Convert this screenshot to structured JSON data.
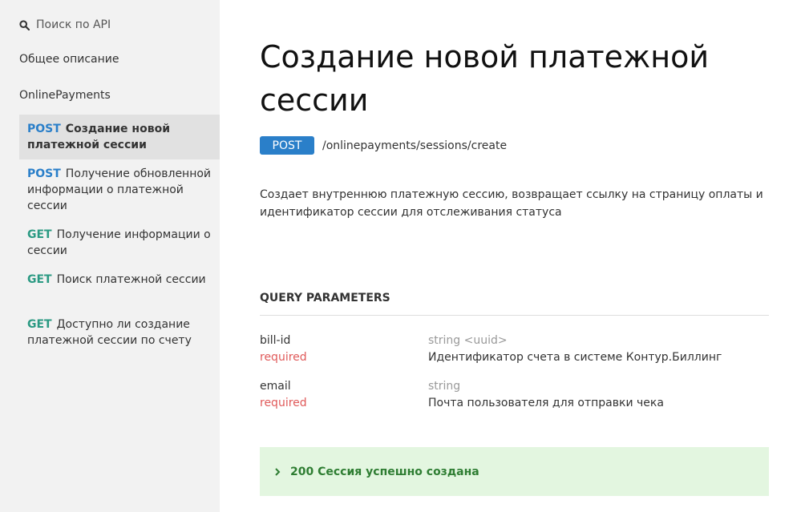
{
  "sidebar": {
    "search_label": "Поиск по API",
    "overview_label": "Общее описание",
    "group_label": "OnlinePayments",
    "items": [
      {
        "method": "POST",
        "label": "Создание новой платежной сессии",
        "active": true
      },
      {
        "method": "POST",
        "label": "Получение обновленной информации о платежной сессии"
      },
      {
        "method": "GET",
        "label": "Получение информации о сессии"
      },
      {
        "method": "GET",
        "label": "Поиск платежной сессии"
      },
      {
        "method": "GET",
        "label": "Доступно ли создание платежной сессии по счету"
      }
    ]
  },
  "main": {
    "title": "Создание новой платежной сессии",
    "method": "POST",
    "path": "/onlinepayments/sessions/create",
    "description": "Создает внутреннюю платежную сессию, возвращает ссылку на страницу оплаты и идентификатор сессии для отслеживания статуса",
    "query_title": "QUERY PARAMETERS",
    "params": [
      {
        "name": "bill-id",
        "required": "required",
        "type": "string <uuid>",
        "description": "Идентификатор счета в системе Контур.Биллинг"
      },
      {
        "name": "email",
        "required": "required",
        "type": "string",
        "description": "Почта пользователя для отправки чека"
      }
    ],
    "response": "200 Сессия успешно создана"
  },
  "colors": {
    "post": "#2a7fc9",
    "get": "#2b9a83",
    "required": "#e05a5a",
    "response_bg": "#e3f6e0",
    "response_text": "#2e7d32"
  },
  "icons": {
    "search": "search-icon",
    "expand": "chevron-right-icon"
  }
}
